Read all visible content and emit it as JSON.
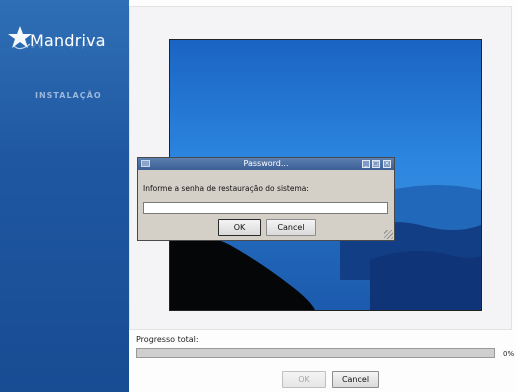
{
  "sidebar": {
    "logo_text": "Mandriva",
    "logo_icon": "star-logo-icon",
    "step_label": "INSTALAÇÃO"
  },
  "main": {
    "progress_label": "Progresso total:",
    "progress_value": 0,
    "progress_percent_text": "0%",
    "ok_label": "OK",
    "cancel_label": "Cancel"
  },
  "dialog": {
    "title": "Password...",
    "prompt": "Informe a senha de restauração do sistema:",
    "input_value": "",
    "ok_label": "OK",
    "cancel_label": "Cancel",
    "titlebar_buttons": [
      "minimize-icon",
      "maximize-icon",
      "close-icon"
    ]
  },
  "colors": {
    "sidebar_blue": "#1f58a1",
    "titlebar_blue": "#3b5f96",
    "dialog_gray": "#d4d0c8"
  }
}
